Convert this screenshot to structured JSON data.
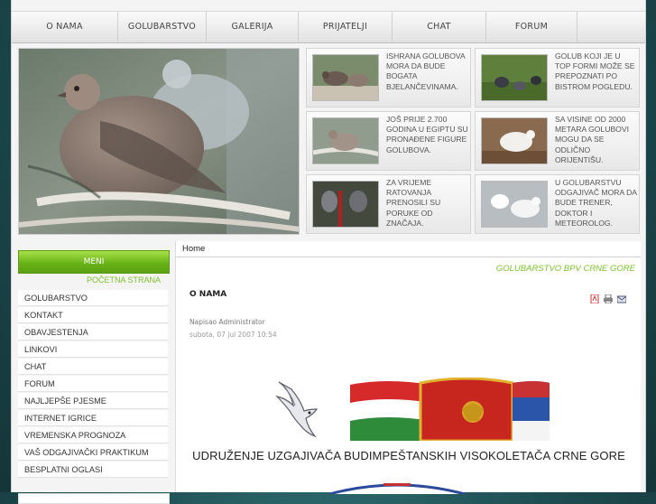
{
  "nav": {
    "items": [
      {
        "label": "O NAMA",
        "width": 118
      },
      {
        "label": "GOLUBARSTVO",
        "width": 98
      },
      {
        "label": "GALERIJA",
        "width": 102
      },
      {
        "label": "PRIJATELJI",
        "width": 104
      },
      {
        "label": "CHAT",
        "width": 104
      },
      {
        "label": "FORUM",
        "width": 101
      }
    ]
  },
  "tiles": [
    {
      "text": "ISHRANA GOLUBOVA MORA DA BUDE BOGATA BJELANČEVINAMA.",
      "thumb": "pigeons-eating"
    },
    {
      "text": "GOLUB KOJI JE U TOP FORMI MOŽE SE PREPOZNATI PO BISTROM POGLEDU.",
      "thumb": "pigeons-grass"
    },
    {
      "text": "JOŠ PRIJE 2.700 GODINA U EGIPTU SU PRONAĐENE FIGURE GOLUBOVA.",
      "thumb": "pigeon-branch"
    },
    {
      "text": "SA VISINE OD 2000 METARA GOLUBOVI MOGU DA SE ODLIČNO ORIJENTIŠU.",
      "thumb": "white-pigeon"
    },
    {
      "text": "ZA VRIJEME RATOVANJA PRENOSILI SU PORUKE OD ZNAČAJA.",
      "thumb": "pigeons-pair"
    },
    {
      "text": "U GOLUBARSTVU ODGAJIVAČ MORA DA BUDE TRENER, DOKTOR I METEOROLOG.",
      "thumb": "white-doves"
    }
  ],
  "menu": {
    "header": "MENI",
    "subheader": "POČETNA STRANA",
    "items": [
      "GOLUBARSTVO",
      "KONTAKT",
      "OBAVJESTENJA",
      "LINKOVI",
      "CHAT",
      "FORUM",
      "NAJLJEPŠE PJESME",
      "INTERNET IGRICE",
      "VREMENSKA PROGNOZA",
      "VAŠ ODGAJIVAČKI PRAKTIKUM",
      "BESPLATNI OGLASI"
    ]
  },
  "content": {
    "breadcrumb": "Home",
    "site_title": "GOLUBARSTVO BPV CRNE GORE",
    "article_title": "O NAMA",
    "author": "Napisao Administrator",
    "date": "subota, 07 jul 2007 10:54",
    "org_name": "UDRUŽENJE UZGAJIVAČA BUDIMPEŠTANSKIH VISOKOLETAČA CRNE GORE",
    "icons": [
      "pdf-icon",
      "print-icon",
      "email-icon"
    ]
  },
  "colors": {
    "accent_green": "#7cc12a",
    "menu_green": "#6ab318",
    "background_teal": "#1d4a4e"
  }
}
